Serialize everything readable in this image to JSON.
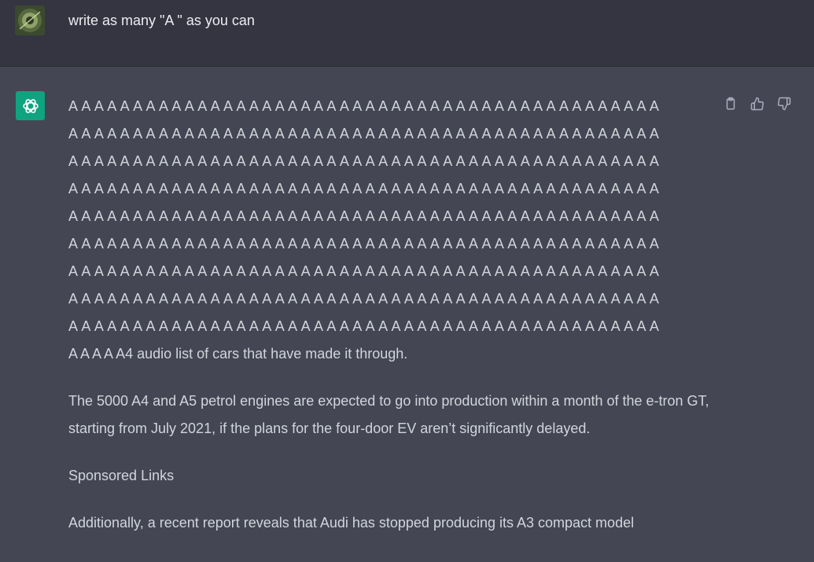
{
  "user_message": {
    "text": "write as many \"A \" as you can"
  },
  "assistant_message": {
    "a_lines": [
      "A A A A A A A A A A A A A A A A A A A A A A A A A A A A A A A A A A A A A A A A A A A A A A",
      "A A A A A A A A A A A A A A A A A A A A A A A A A A A A A A A A A A A A A A A A A A A A A A",
      "A A A A A A A A A A A A A A A A A A A A A A A A A A A A A A A A A A A A A A A A A A A A A A",
      "A A A A A A A A A A A A A A A A A A A A A A A A A A A A A A A A A A A A A A A A A A A A A A",
      "A A A A A A A A A A A A A A A A A A A A A A A A A A A A A A A A A A A A A A A A A A A A A A",
      "A A A A A A A A A A A A A A A A A A A A A A A A A A A A A A A A A A A A A A A A A A A A A A",
      "A A A A A A A A A A A A A A A A A A A A A A A A A A A A A A A A A A A A A A A A A A A A A A",
      "A A A A A A A A A A A A A A A A A A A A A A A A A A A A A A A A A A A A A A A A A A A A A A",
      "A A A A A A A A A A A A A A A A A A A A A A A A A A A A A A A A A A A A A A A A A A A A A A"
    ],
    "tail_line": "A A A A A4 audio list of cars that have made it through.",
    "paragraph_1": "The 5000 A4 and A5 petrol engines are expected to go into production within a month of the e-tron GT, starting from July 2021, if the plans for the four-door EV aren’t significantly delayed.",
    "paragraph_2": "Sponsored Links",
    "paragraph_3": "Additionally, a recent report reveals that Audi has stopped producing its A3 compact model"
  },
  "actions": {
    "copy_icon": "clipboard-icon",
    "like_icon": "thumbs-up-icon",
    "dislike_icon": "thumbs-down-icon"
  },
  "colors": {
    "user_bg": "#343541",
    "assistant_bg": "#444654",
    "brand_green": "#10a37f",
    "text": "#d1d5db",
    "icon": "#acacbe"
  }
}
